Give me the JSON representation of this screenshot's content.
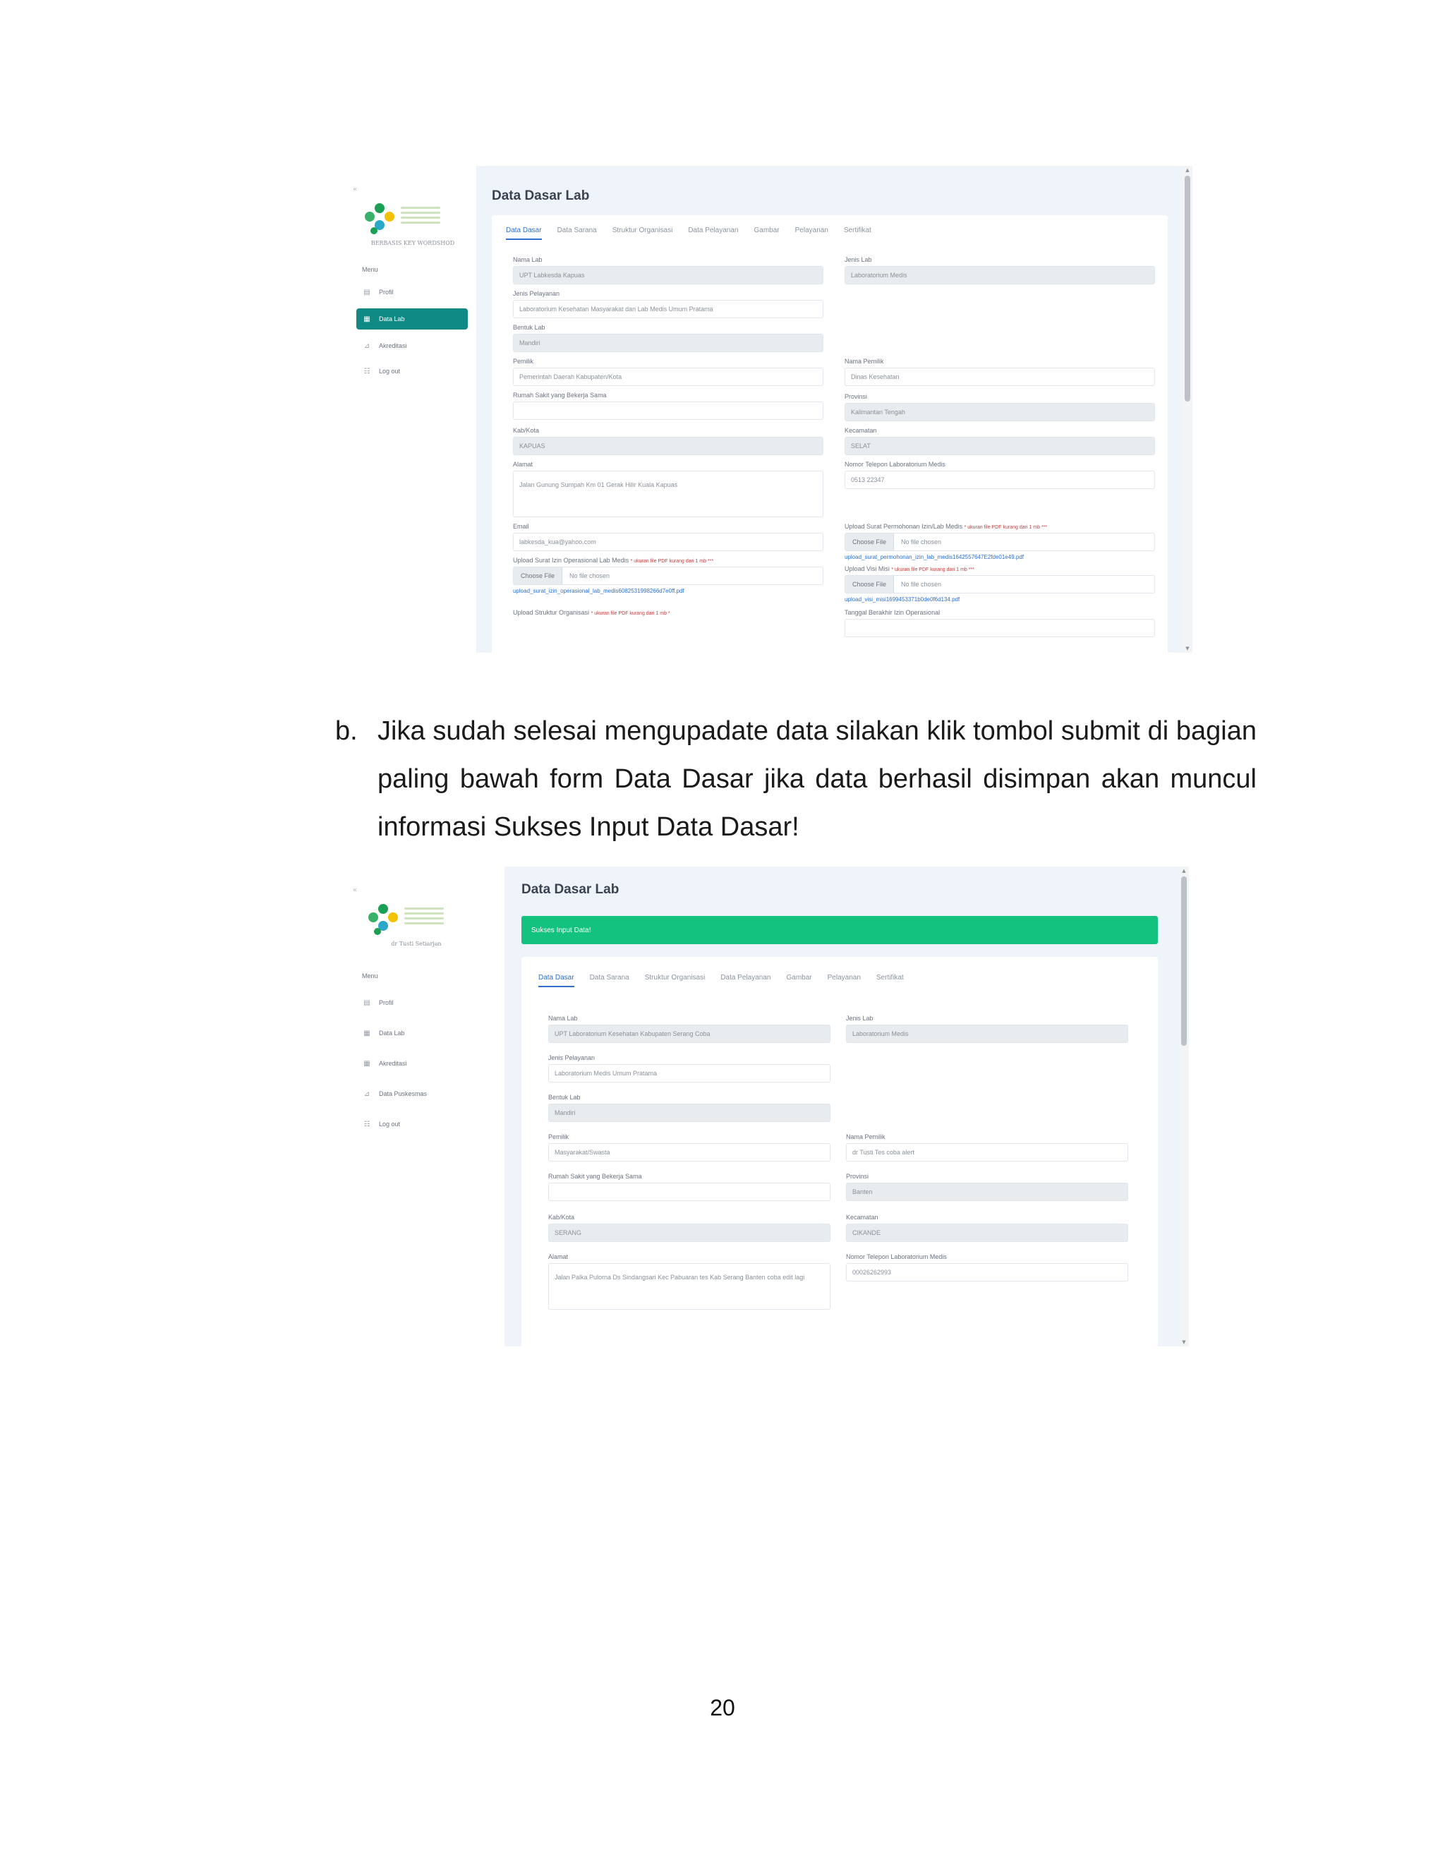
{
  "screenshot1": {
    "sidebar": {
      "logo_caption": "BERBASIS KEY WORDSHOD",
      "menu_title": "Menu",
      "items": [
        {
          "icon": "document-icon",
          "label": "Profil",
          "active": false
        },
        {
          "icon": "chart-icon",
          "label": "Data Lab",
          "active": true
        },
        {
          "icon": "chart-icon",
          "label": "Akreditasi",
          "active": false
        },
        {
          "icon": "logout-icon",
          "label": "Log out",
          "active": false
        }
      ]
    },
    "title": "Data Dasar Lab",
    "tabs": [
      "Data Dasar",
      "Data Sarana",
      "Struktur Organisasi",
      "Data Pelayanan",
      "Gambar",
      "Pelayanan",
      "Sertifikat"
    ],
    "active_tab": "Data Dasar",
    "fields": {
      "nama_lab": {
        "label": "Nama Lab",
        "value": "UPT Labkesda Kapuas"
      },
      "jenis_lab": {
        "label": "Jenis Lab",
        "value": "Laboratorium Medis"
      },
      "jenis_pelayanan": {
        "label": "Jenis Pelayanan",
        "value": "Laboratorium Kesehatan Masyarakat dan Lab Medis Umum Pratama"
      },
      "bentuk_lab": {
        "label": "Bentuk Lab",
        "value": "Mandiri"
      },
      "pemilik": {
        "label": "Pemilik",
        "value": "Pemerintah Daerah Kabupaten/Kota"
      },
      "nama_pemilik": {
        "label": "Nama Pemilik",
        "value": "Dinas Kesehatan"
      },
      "rumah_sakit": {
        "label": "Rumah Sakit yang Bekerja Sama",
        "value": ""
      },
      "provinsi": {
        "label": "Provinsi",
        "value": "Kalimantan Tengah"
      },
      "kabkota": {
        "label": "Kab/Kota",
        "value": "KAPUAS"
      },
      "kecamatan": {
        "label": "Kecamatan",
        "value": "SELAT"
      },
      "alamat": {
        "label": "Alamat",
        "value": "Jalan Gunung Sumpah Km 01 Gerak Hilir Kuala Kapuas"
      },
      "nomor_telepon": {
        "label": "Nomor Telepon Laboratorium Medis",
        "value": "0513 22347"
      },
      "email": {
        "label": "Email",
        "value": "labkesda_kua@yahoo.com"
      },
      "upload_izin_pendirian": {
        "label": "Upload Surat Permohonan Izin/Lab Medis",
        "hint": "* ukuran file PDF kurang dari 1 mb ***",
        "button": "Choose File",
        "none": "No file chosen",
        "link": "upload_surat_permohonan_izin_lab_medis1642557647E2fde01e49.pdf"
      },
      "upload_izin_operasional": {
        "label": "Upload Surat Izin Operasional Lab Medis",
        "hint": "* ukuran file PDF kurang dari 1 mb ***",
        "button": "Choose File",
        "none": "No file chosen",
        "link": "upload_surat_izin_operasional_lab_medis6082531998266d7e0ff.pdf"
      },
      "upload_visi_misi": {
        "label": "Upload Visi Misi",
        "hint": "* ukuran file PDF kurang dari 1 mb ***",
        "button": "Choose File",
        "none": "No file chosen",
        "link": "upload_visi_misi1699453371b0de0f6d134.pdf"
      },
      "upload_struktur": {
        "label": "Upload Struktur Organisasi",
        "hint": "* ukuran file PDF kurang dari 1 mb *"
      },
      "tanggal_izin": {
        "label": "Tanggal Berakhir Izin Operasional",
        "value": ""
      }
    }
  },
  "instruction": {
    "marker": "b.",
    "text": "Jika sudah selesai mengupadate data silakan klik tombol submit di bagian paling bawah form Data Dasar jika data berhasil disimpan akan muncul informasi Sukses Input Data Dasar!"
  },
  "screenshot2": {
    "sidebar": {
      "logo_caption": "dr Tusti Setiarjan",
      "menu_title": "Menu",
      "items": [
        {
          "icon": "document-icon",
          "label": "Profil",
          "active": false
        },
        {
          "icon": "chart-icon",
          "label": "Data Lab",
          "active": false
        },
        {
          "icon": "chart-icon",
          "label": "Akreditasi",
          "active": false
        },
        {
          "icon": "chart-icon",
          "label": "Data Puskesmas",
          "active": false
        },
        {
          "icon": "logout-icon",
          "label": "Log out",
          "active": false
        }
      ]
    },
    "title": "Data Dasar Lab",
    "alert": "Sukses Input Data!",
    "tabs": [
      "Data Dasar",
      "Data Sarana",
      "Struktur Organisasi",
      "Data Pelayanan",
      "Gambar",
      "Pelayanan",
      "Sertifikat"
    ],
    "active_tab": "Data Dasar",
    "fields": {
      "nama_lab": {
        "label": "Nama Lab",
        "value": "UPT Laboratorium Kesehatan Kabupaten Serang Coba"
      },
      "jenis_lab": {
        "label": "Jenis Lab",
        "value": "Laboratorium Medis"
      },
      "jenis_pelayanan": {
        "label": "Jenis Pelayanan",
        "value": "Laboratorium Medis Umum Pratama"
      },
      "bentuk_lab": {
        "label": "Bentuk Lab",
        "value": "Mandiri"
      },
      "pemilik": {
        "label": "Pemilik",
        "value": "Masyarakat/Swasta"
      },
      "nama_pemilik": {
        "label": "Nama Pemilik",
        "value": "dr Tusti Tes coba alert"
      },
      "rumah_sakit": {
        "label": "Rumah Sakit yang Bekerja Sama",
        "value": ""
      },
      "provinsi": {
        "label": "Provinsi",
        "value": "Banten"
      },
      "kabkota": {
        "label": "Kab/Kota",
        "value": "SERANG"
      },
      "kecamatan": {
        "label": "Kecamatan",
        "value": "CIKANDE"
      },
      "alamat": {
        "label": "Alamat",
        "value": "Jalan Palka Pulorna Ds Sindangsari Kec Pabuaran tes Kab Serang Banten coba edit lagi"
      },
      "nomor_telepon": {
        "label": "Nomor Telepon Laboratorium Medis",
        "value": "00026262993"
      }
    }
  },
  "page_number": "20"
}
